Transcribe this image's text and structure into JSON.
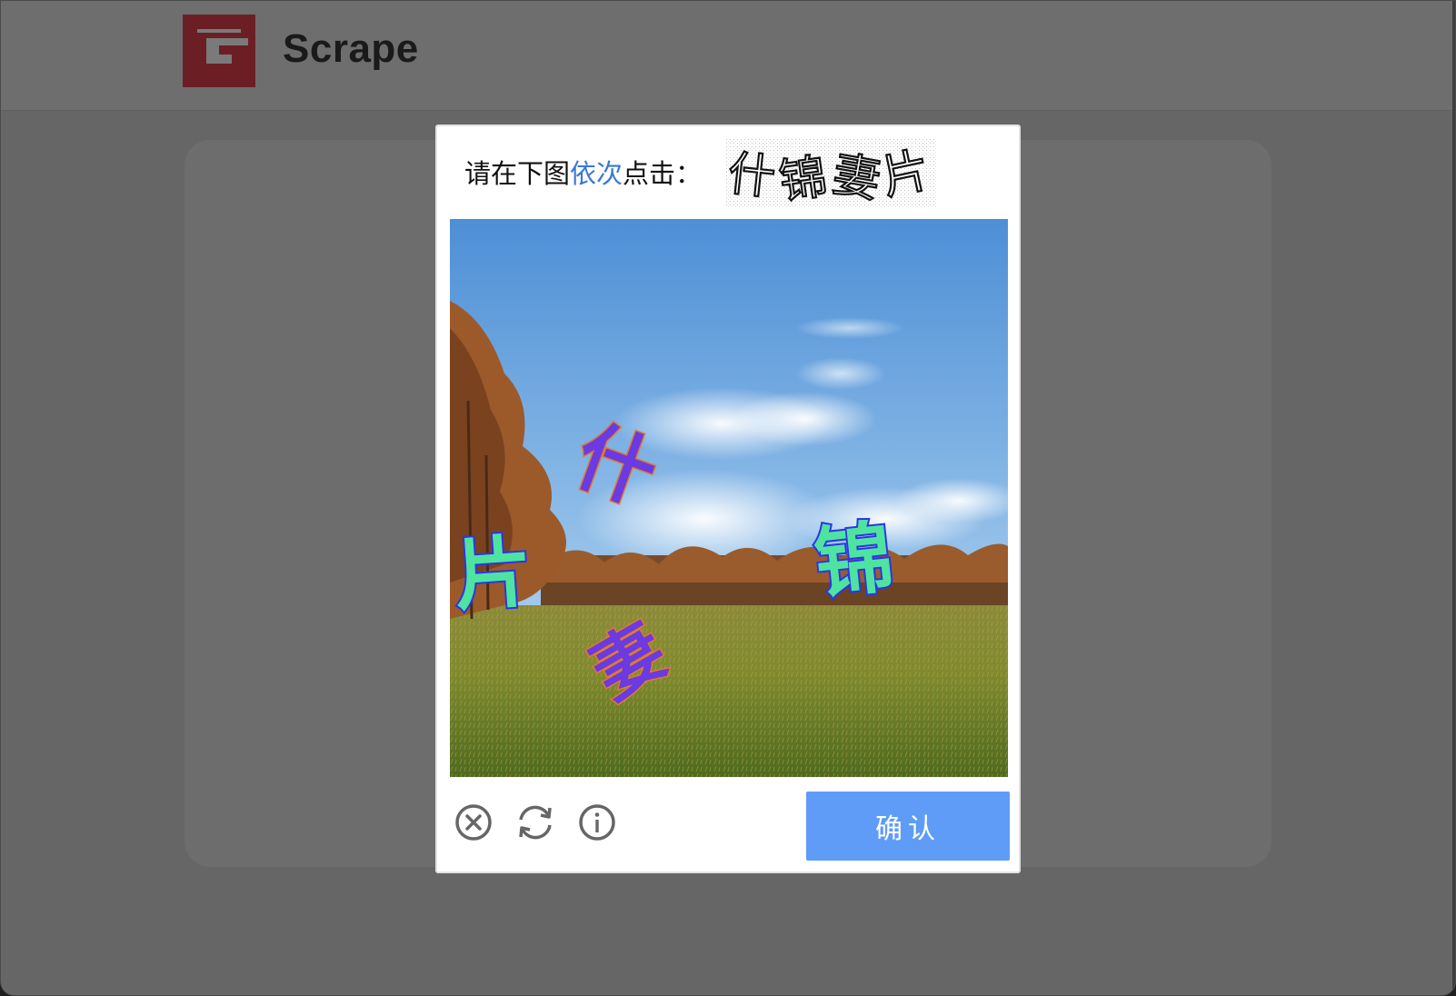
{
  "site": {
    "brand_name": "Scrape"
  },
  "captcha": {
    "prompt_prefix": "请在下图",
    "prompt_highlight": "依次",
    "prompt_suffix": "点击：",
    "target_characters": [
      "什",
      "锦",
      "妻",
      "片"
    ],
    "scene_characters": [
      {
        "char": "什",
        "style": "purple"
      },
      {
        "char": "锦",
        "style": "green"
      },
      {
        "char": "妻",
        "style": "purple"
      },
      {
        "char": "片",
        "style": "green"
      }
    ],
    "icons": [
      "close-circle-icon",
      "refresh-icon",
      "info-icon"
    ],
    "confirm_label": "确认",
    "colors": {
      "highlight": "#3a78d6",
      "confirm_button": "#5f9cf8",
      "logo": "#8b1a22"
    }
  }
}
